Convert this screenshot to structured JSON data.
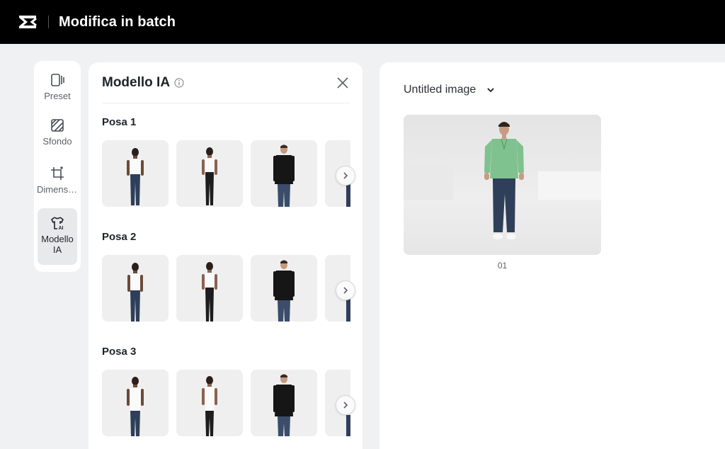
{
  "app": {
    "title": "Modifica in batch",
    "logo_icon": "capcut-logo-icon"
  },
  "rail": {
    "items": [
      {
        "label": "Preset",
        "icon": "preset-icon",
        "active": false
      },
      {
        "label": "Sfondo",
        "icon": "background-icon",
        "active": false
      },
      {
        "label": "Dimensioni",
        "icon": "crop-resize-icon",
        "active": false
      },
      {
        "label": "Modello IA",
        "icon": "ai-model-shirt-icon",
        "active": true
      }
    ]
  },
  "panel": {
    "title": "Modello IA",
    "info_icon": "info-icon",
    "close_icon": "close-icon",
    "sections": [
      {
        "label": "Posa 1",
        "thumbs": [
          "model-woman-white-tank-jeans",
          "model-woman-white-tank-black-pants",
          "model-man-black-sweater-jeans",
          "model-partial"
        ]
      },
      {
        "label": "Posa 2",
        "thumbs": [
          "model-woman-white-tank-jeans",
          "model-woman-white-tank-black-pants",
          "model-man-black-sweater-jeans",
          "model-partial"
        ]
      },
      {
        "label": "Posa 3",
        "thumbs": [
          "model-woman-white-tank-jeans",
          "model-woman-white-tank-black-pants",
          "model-man-black-sweater-jeans",
          "model-partial"
        ]
      }
    ]
  },
  "canvas": {
    "image_name": "Untitled image",
    "preview_label": "01",
    "dropdown_icon": "chevron-down-icon"
  },
  "colors": {
    "topbar": "#000000",
    "background": "#f0f1f2",
    "active_rail": "#e8e9eb",
    "shirt_green": "#7fc28f",
    "jeans": "#2f3f59"
  }
}
